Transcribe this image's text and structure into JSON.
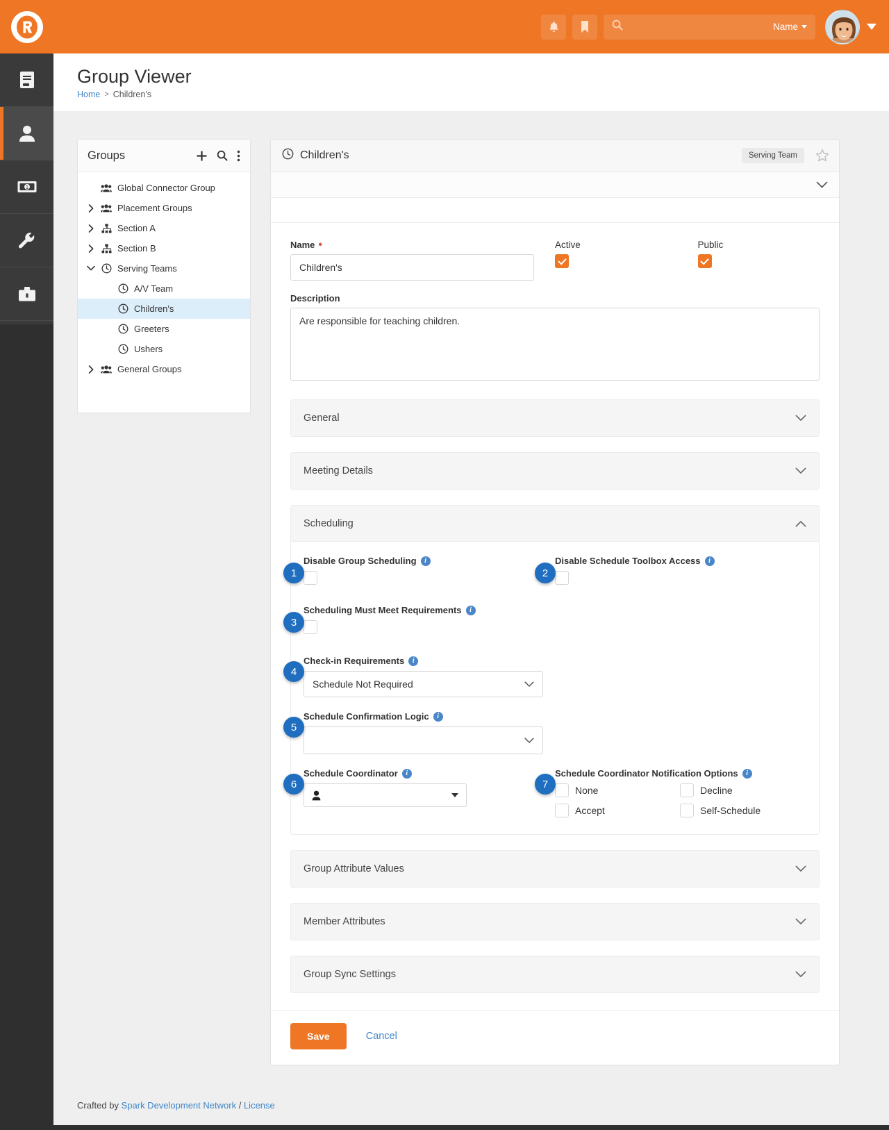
{
  "brand": {
    "accent": "#ee7625",
    "link": "#3f86c8",
    "callout": "#1f6ec0",
    "logo_name": "rock-rms-logo"
  },
  "topbar": {
    "notifications_icon": "bell-icon",
    "bookmark_icon": "bookmark-icon",
    "search_icon": "search-icon",
    "search_placeholder": "",
    "search_value": "",
    "scope_label": "Name",
    "avatar_name": "user-avatar",
    "user_menu_icon": "chevron-down-icon"
  },
  "leftnav": {
    "items": [
      {
        "name": "cms-icon",
        "icon": "book-icon",
        "active": false
      },
      {
        "name": "people-icon",
        "icon": "person-icon",
        "active": true
      },
      {
        "name": "finance-icon",
        "icon": "money-bill-icon",
        "active": false
      },
      {
        "name": "admin-tools-icon",
        "icon": "wrench-icon",
        "active": false
      },
      {
        "name": "power-tools-icon",
        "icon": "briefcase-icon",
        "active": false
      }
    ]
  },
  "page": {
    "title": "Group Viewer",
    "breadcrumb": {
      "home": "Home",
      "separator": ">",
      "current": "Children's"
    }
  },
  "groups_panel": {
    "title": "Groups",
    "add_icon": "plus-icon",
    "search_icon": "search-icon",
    "more_icon": "ellipsis-vertical-icon",
    "tree": [
      {
        "label": "Global Connector Group",
        "icon": "people-group-icon",
        "indent": 0,
        "expander": "none",
        "selected": false
      },
      {
        "label": "Placement Groups",
        "icon": "people-group-icon",
        "indent": 0,
        "expander": "collapsed",
        "selected": false
      },
      {
        "label": "Section A",
        "icon": "sitemap-icon",
        "indent": 0,
        "expander": "collapsed",
        "selected": false
      },
      {
        "label": "Section B",
        "icon": "sitemap-icon",
        "indent": 0,
        "expander": "collapsed",
        "selected": false
      },
      {
        "label": "Serving Teams",
        "icon": "clock-icon",
        "indent": 0,
        "expander": "expanded",
        "selected": false
      },
      {
        "label": "A/V Team",
        "icon": "clock-icon",
        "indent": 1,
        "expander": "none",
        "selected": false
      },
      {
        "label": "Children's",
        "icon": "clock-icon",
        "indent": 1,
        "expander": "none",
        "selected": true
      },
      {
        "label": "Greeters",
        "icon": "clock-icon",
        "indent": 1,
        "expander": "none",
        "selected": false
      },
      {
        "label": "Ushers",
        "icon": "clock-icon",
        "indent": 1,
        "expander": "none",
        "selected": false
      },
      {
        "label": "General Groups",
        "icon": "people-group-icon",
        "indent": 0,
        "expander": "collapsed",
        "selected": false
      }
    ]
  },
  "card": {
    "title": "Children's",
    "title_icon": "clock-icon",
    "badge": "Serving Team",
    "star_icon": "star-outline-icon",
    "subbar_chevron": "chevron-down-icon"
  },
  "form": {
    "name_label": "Name",
    "name_required_marker": "*",
    "name_value": "Children's",
    "active_label": "Active",
    "active_checked": true,
    "public_label": "Public",
    "public_checked": true,
    "description_label": "Description",
    "description_value": "Are responsible for teaching children."
  },
  "sections": [
    {
      "title": "General",
      "open": false,
      "chevron": "chevron-down-icon"
    },
    {
      "title": "Meeting Details",
      "open": false,
      "chevron": "chevron-down-icon"
    },
    {
      "title": "Scheduling",
      "open": true,
      "chevron": "chevron-up-icon"
    },
    {
      "title": "Group Attribute Values",
      "open": false,
      "chevron": "chevron-down-icon"
    },
    {
      "title": "Member Attributes",
      "open": false,
      "chevron": "chevron-down-icon"
    },
    {
      "title": "Group Sync Settings",
      "open": false,
      "chevron": "chevron-down-icon"
    }
  ],
  "scheduling": {
    "disable_group_scheduling": {
      "callout": "1",
      "label": "Disable Group Scheduling",
      "info_icon": "info-circle-icon",
      "checked": false
    },
    "disable_toolbox_access": {
      "callout": "2",
      "label": "Disable Schedule Toolbox Access",
      "info_icon": "info-circle-icon",
      "checked": false
    },
    "must_meet_requirements": {
      "callout": "3",
      "label": "Scheduling Must Meet Requirements",
      "info_icon": "info-circle-icon",
      "checked": false
    },
    "checkin_requirements": {
      "callout": "4",
      "label": "Check-in Requirements",
      "info_icon": "info-circle-icon",
      "value": "Schedule Not Required",
      "chevron": "chevron-down-icon"
    },
    "confirmation_logic": {
      "callout": "5",
      "label": "Schedule Confirmation Logic",
      "info_icon": "info-circle-icon",
      "value": "",
      "chevron": "chevron-down-icon"
    },
    "coordinator": {
      "callout": "6",
      "label": "Schedule Coordinator",
      "info_icon": "info-circle-icon",
      "value": "",
      "person_icon": "person-icon",
      "dropdown_icon": "caret-down-icon"
    },
    "notification_options": {
      "callout": "7",
      "label": "Schedule Coordinator Notification Options",
      "info_icon": "info-circle-icon",
      "options": [
        {
          "label": "None",
          "checked": false
        },
        {
          "label": "Decline",
          "checked": false
        },
        {
          "label": "Accept",
          "checked": false
        },
        {
          "label": "Self-Schedule",
          "checked": false
        }
      ]
    }
  },
  "actions": {
    "save_label": "Save",
    "cancel_label": "Cancel"
  },
  "footer": {
    "prefix": "Crafted by",
    "org_link": "Spark Development Network",
    "divider": "/",
    "license_link": "License"
  }
}
